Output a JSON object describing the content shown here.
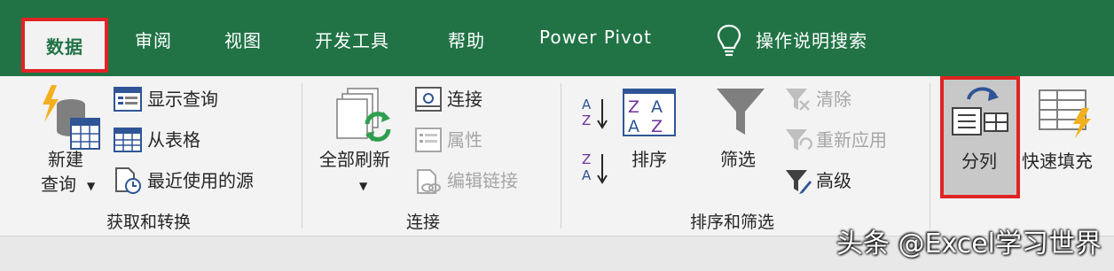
{
  "tabs": {
    "data": "数据",
    "review": "审阅",
    "view": "视图",
    "developer": "开发工具",
    "help": "帮助",
    "power_pivot": "Power Pivot",
    "tell_me": "操作说明搜索"
  },
  "groups": {
    "get_transform": {
      "label": "获取和转换",
      "new_query_line1": "新建",
      "new_query_line2": "查询",
      "show_queries": "显示查询",
      "from_table": "从表格",
      "recent_sources": "最近使用的源"
    },
    "connections": {
      "label": "连接",
      "refresh_all": "全部刷新",
      "connections": "连接",
      "properties": "属性",
      "edit_links": "编辑链接"
    },
    "sort_filter": {
      "label": "排序和筛选",
      "sort": "排序",
      "filter": "筛选",
      "clear": "清除",
      "reapply": "重新应用",
      "advanced": "高级"
    },
    "data_tools": {
      "text_to_columns": "分列",
      "flash_fill": "快速填充"
    }
  },
  "watermark": "头条 @Excel学习世界",
  "colors": {
    "excel_green": "#217346",
    "highlight_red": "#e02424",
    "ribbon_bg": "#f3f3f3"
  },
  "icons": [
    "lightbulb-icon",
    "database-lightning-icon",
    "table-icon",
    "clock-doc-icon",
    "refresh-icon",
    "link-icon",
    "properties-icon",
    "chain-icon",
    "sort-az-icon",
    "sort-za-icon",
    "sort-dialog-icon",
    "funnel-icon",
    "clear-filter-icon",
    "reapply-icon",
    "advanced-filter-icon",
    "text-to-columns-icon",
    "flash-fill-icon"
  ]
}
